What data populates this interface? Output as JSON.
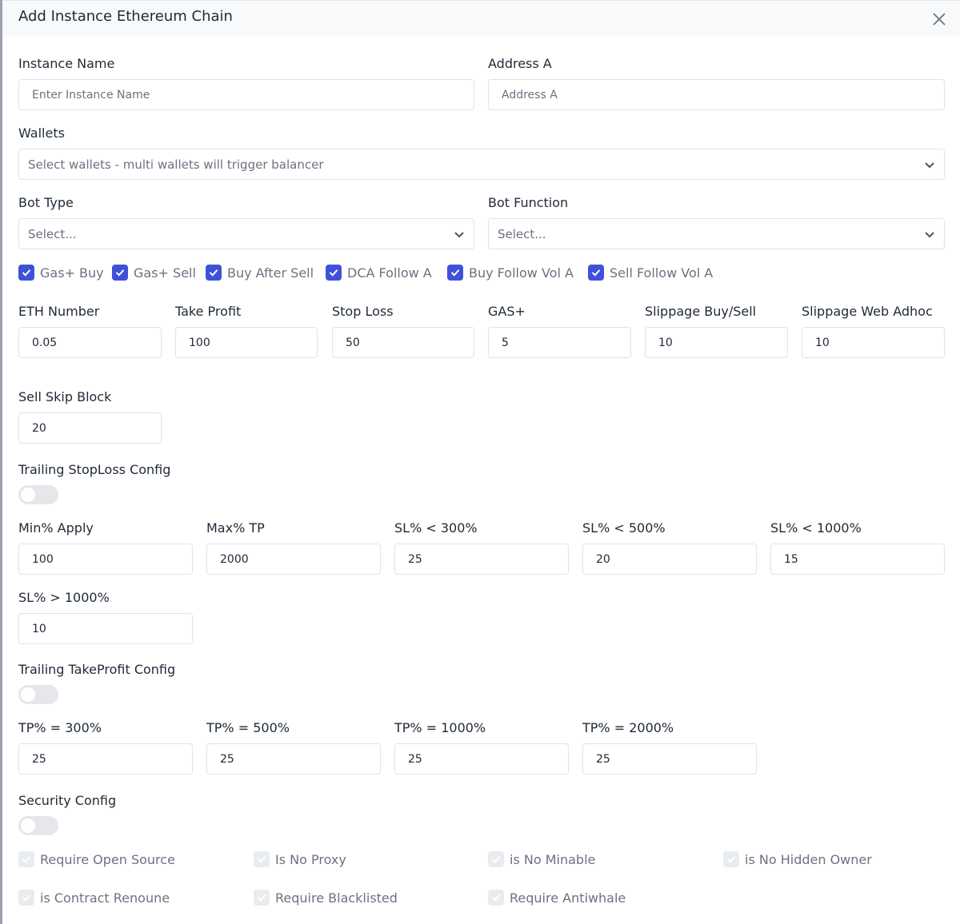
{
  "modal": {
    "title": "Add Instance Ethereum Chain"
  },
  "instance_name": {
    "label": "Instance Name",
    "placeholder": "Enter Instance Name",
    "value": ""
  },
  "address_a": {
    "label": "Address A",
    "placeholder": "Address A",
    "value": ""
  },
  "wallets": {
    "label": "Wallets",
    "placeholder": "Select wallets - multi wallets will trigger balancer"
  },
  "bot_type": {
    "label": "Bot Type",
    "placeholder": "Select..."
  },
  "bot_function": {
    "label": "Bot Function",
    "placeholder": "Select..."
  },
  "options": [
    {
      "label": "Gas+ Buy",
      "checked": true
    },
    {
      "label": "Gas+ Sell",
      "checked": true
    },
    {
      "label": "Buy After Sell",
      "checked": true
    },
    {
      "label": "DCA Follow A",
      "checked": true
    },
    {
      "label": "Buy Follow Vol A",
      "checked": true
    },
    {
      "label": "Sell Follow Vol A",
      "checked": true
    }
  ],
  "params": [
    {
      "label": "ETH Number",
      "value": "0.05"
    },
    {
      "label": "Take Profit",
      "value": "100"
    },
    {
      "label": "Stop Loss",
      "value": "50"
    },
    {
      "label": "GAS+",
      "value": "5"
    },
    {
      "label": "Slippage Buy/Sell",
      "value": "10"
    },
    {
      "label": "Slippage Web Adhoc",
      "value": "10"
    },
    {
      "label": "Sell Skip Block",
      "value": "20"
    }
  ],
  "trailing_stoploss": {
    "label": "Trailing StopLoss Config",
    "enabled": false,
    "fields": [
      {
        "label": "Min% Apply",
        "value": "100"
      },
      {
        "label": "Max% TP",
        "value": "2000"
      },
      {
        "label": "SL% < 300%",
        "value": "25"
      },
      {
        "label": "SL% < 500%",
        "value": "20"
      },
      {
        "label": "SL% < 1000%",
        "value": "15"
      },
      {
        "label": "SL% > 1000%",
        "value": "10"
      }
    ]
  },
  "trailing_takeprofit": {
    "label": "Trailing TakeProfit Config",
    "enabled": false,
    "fields": [
      {
        "label": "TP% = 300%",
        "value": "25"
      },
      {
        "label": "TP% = 500%",
        "value": "25"
      },
      {
        "label": "TP% = 1000%",
        "value": "25"
      },
      {
        "label": "TP% = 2000%",
        "value": "25"
      }
    ]
  },
  "security": {
    "label": "Security Config",
    "enabled": false,
    "options": [
      {
        "label": "Require Open Source",
        "checked": true,
        "disabled": true
      },
      {
        "label": "Is No Proxy",
        "checked": true,
        "disabled": true
      },
      {
        "label": "is No Minable",
        "checked": true,
        "disabled": true
      },
      {
        "label": "is No Hidden Owner",
        "checked": true,
        "disabled": true
      },
      {
        "label": "is Contract Renoune",
        "checked": true,
        "disabled": true
      },
      {
        "label": "Require Blacklisted",
        "checked": true,
        "disabled": true
      },
      {
        "label": "Require Antiwhale",
        "checked": true,
        "disabled": true
      }
    ]
  },
  "colors": {
    "accent": "#3f51d9",
    "border": "#dfe3e8",
    "header_bg": "#f8f9fa",
    "toggle_off": "#e5e7eb"
  }
}
